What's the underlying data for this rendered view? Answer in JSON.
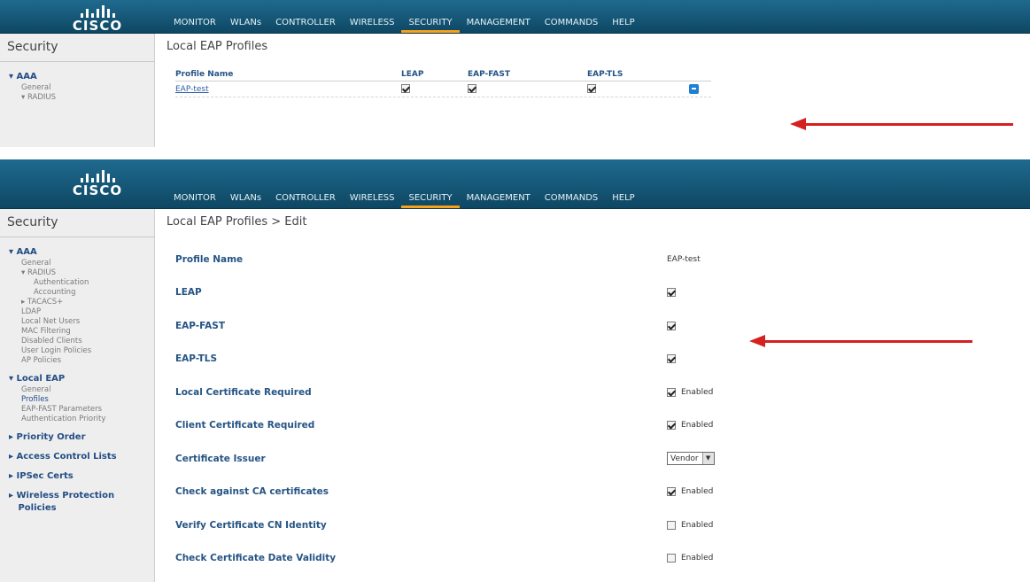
{
  "header": {
    "logo_text": "CISCO",
    "menu": [
      "MONITOR",
      "WLANs",
      "CONTROLLER",
      "WIRELESS",
      "SECURITY",
      "MANAGEMENT",
      "COMMANDS",
      "HELP"
    ],
    "active_menu": "SECURITY"
  },
  "sidebar": {
    "title": "Security",
    "aaa": "AAA",
    "general": "General",
    "radius": "RADIUS",
    "authentication": "Authentication",
    "accounting": "Accounting",
    "tacacs": "TACACS+",
    "ldap": "LDAP",
    "local_net_users": "Local Net Users",
    "mac_filtering": "MAC Filtering",
    "disabled_clients": "Disabled Clients",
    "user_login_policies": "User Login Policies",
    "ap_policies": "AP Policies",
    "local_eap": "Local EAP",
    "local_eap_general": "General",
    "profiles": "Profiles",
    "eap_fast_params": "EAP-FAST Parameters",
    "auth_priority": "Authentication Priority",
    "priority_order": "Priority Order",
    "acl": "Access Control Lists",
    "ipsec": "IPSec Certs",
    "wireless_protection_1": "Wireless Protection",
    "wireless_protection_2": "Policies"
  },
  "list_view": {
    "page_title": "Local EAP Profiles",
    "columns": [
      "Profile Name",
      "LEAP",
      "EAP-FAST",
      "EAP-TLS"
    ],
    "rows": [
      {
        "name": "EAP-test",
        "leap": true,
        "eap_fast": true,
        "eap_tls": true
      }
    ]
  },
  "edit_view": {
    "page_title": "Local EAP Profiles > Edit",
    "profile_name_label": "Profile Name",
    "profile_name_value": "EAP-test",
    "leap_label": "LEAP",
    "eap_fast_label": "EAP-FAST",
    "eap_tls_label": "EAP-TLS",
    "local_cert_label": "Local Certificate Required",
    "client_cert_label": "Client Certificate Required",
    "cert_issuer_label": "Certificate Issuer",
    "cert_issuer_value": "Vendor",
    "check_ca_label": "Check against CA certificates",
    "verify_cn_label": "Verify Certificate CN Identity",
    "check_date_label": "Check Certificate Date Validity",
    "enabled_text": "Enabled",
    "checks": {
      "leap": true,
      "eap_fast": true,
      "eap_tls": true,
      "local_cert": true,
      "client_cert": true,
      "check_ca": true,
      "verify_cn": false,
      "check_date": false
    }
  },
  "colors": {
    "header": "#0e4763",
    "active_tab_underline": "#f7a21b",
    "label_blue": "#255485",
    "annotation_arrow": "#d42020"
  }
}
